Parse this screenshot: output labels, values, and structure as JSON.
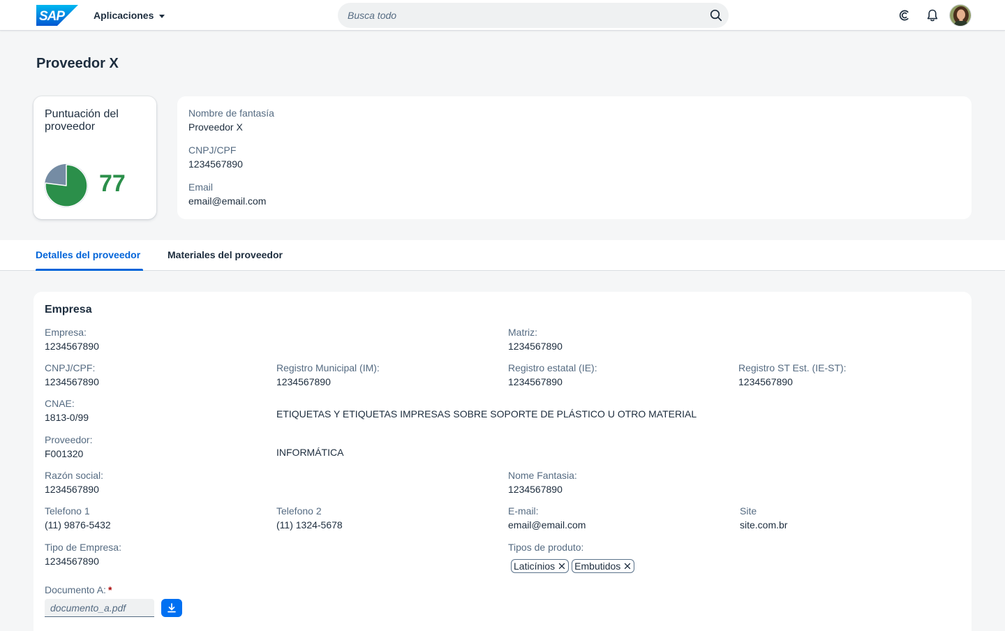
{
  "shell": {
    "logo_text": "SAP",
    "apps_label": "Aplicaciones",
    "search_placeholder": "Busca todo",
    "icons": [
      "search-icon",
      "copilot-icon",
      "bell-icon",
      "avatar"
    ]
  },
  "page": {
    "title": "Proveedor X"
  },
  "score": {
    "title": "Puntuación del proveedor",
    "value": "77",
    "fraction": 0.77,
    "color": "#2b8f4a"
  },
  "info": {
    "fields": [
      {
        "label": "Nombre de fantasía",
        "value": "Proveedor X"
      },
      {
        "label": "CNPJ/CPF",
        "value": "1234567890"
      },
      {
        "label": "Email",
        "value": "email@email.com"
      }
    ]
  },
  "tabs": [
    {
      "label": "Detalles del proveedor",
      "active": true
    },
    {
      "label": "Materiales del proveedor",
      "active": false
    }
  ],
  "section": {
    "title": "Empresa",
    "empresa": {
      "label": "Empresa:",
      "value": "1234567890"
    },
    "matriz": {
      "label": "Matriz:",
      "value": "1234567890"
    },
    "cnpj": {
      "label": "CNPJ/CPF:",
      "value": "1234567890"
    },
    "im": {
      "label": "Registro Municipal (IM):",
      "value": "1234567890"
    },
    "ie": {
      "label": "Registro estatal (IE):",
      "value": "1234567890"
    },
    "iest": {
      "label": "Registro ST Est. (IE-ST):",
      "value": "1234567890"
    },
    "cnae": {
      "label": "CNAE:",
      "value": "1813-0/99",
      "description": "ETIQUETAS Y ETIQUETAS IMPRESAS SOBRE SOPORTE DE PLÁSTICO U OTRO MATERIAL"
    },
    "proveedor": {
      "label": "Proveedor:",
      "value": "F001320",
      "description": "INFORMÁTICA"
    },
    "razon": {
      "label": "Razón social:",
      "value": "1234567890"
    },
    "nome_fantasia": {
      "label": "Nome Fantasia:",
      "value": "1234567890"
    },
    "tel1": {
      "label": "Telefono 1",
      "value": "(11) 9876-5432"
    },
    "tel2": {
      "label": "Telefono 2",
      "value": "(11) 1324-5678"
    },
    "email": {
      "label": "E-mail:",
      "value": "email@email.com"
    },
    "site": {
      "label": "Site",
      "value": "site.com.br"
    },
    "tipo_empresa": {
      "label": "Tipo de Empresa:",
      "value": "1234567890"
    },
    "tipos_produto": {
      "label": "Tipos de produto:",
      "tokens": [
        "Laticínios",
        "Embutidos"
      ]
    },
    "documento": {
      "label": "Documento A:",
      "required_mark": "*",
      "value": "documento_a.pdf"
    }
  },
  "colors": {
    "accent": "#0064d9",
    "score_green": "#2b8f4a",
    "pie_bg": "#758ca4"
  }
}
